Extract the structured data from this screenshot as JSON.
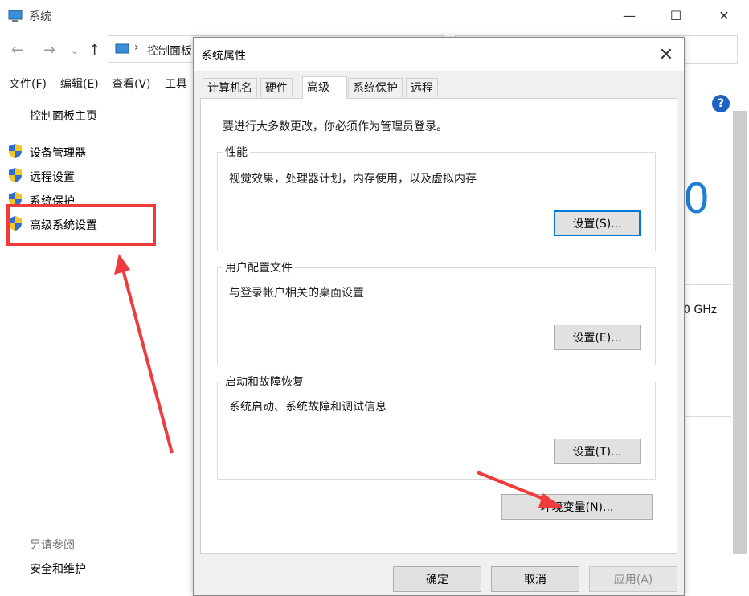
{
  "background_window": {
    "title": "系统",
    "address_path": "控制面板",
    "menu": [
      "文件(F)",
      "编辑(E)",
      "查看(V)",
      "工具"
    ],
    "sidebar": {
      "home": "控制面板主页",
      "items": [
        "设备管理器",
        "远程设置",
        "系统保护",
        "高级系统设置"
      ],
      "see_also_heading": "另请参阅",
      "see_also_items": [
        "安全和维护"
      ]
    },
    "right_fragments": {
      "big_number": "0",
      "cpu_speed": "0 GHz"
    }
  },
  "dialog": {
    "title": "系统属性",
    "tabs": [
      "计算机名",
      "硬件",
      "高级",
      "系统保护",
      "远程"
    ],
    "active_tab": "高级",
    "admin_note": "要进行大多数更改，你必须作为管理员登录。",
    "groups": [
      {
        "label": "性能",
        "description": "视觉效果，处理器计划，内存使用，以及虚拟内存",
        "button": "设置(S)..."
      },
      {
        "label": "用户配置文件",
        "description": "与登录帐户相关的桌面设置",
        "button": "设置(E)..."
      },
      {
        "label": "启动和故障恢复",
        "description": "系统启动、系统故障和调试信息",
        "button": "设置(T)..."
      }
    ],
    "env_button": "环境变量(N)...",
    "footer": {
      "ok": "确定",
      "cancel": "取消",
      "apply": "应用(A)"
    }
  },
  "colors": {
    "highlight_red": "#ef3b3b",
    "focus_blue": "#0078d7",
    "dialog_bg": "#f0f0f0"
  }
}
